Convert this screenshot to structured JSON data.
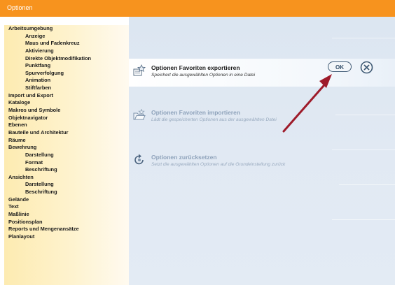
{
  "window": {
    "title": "Optionen"
  },
  "sidebar": {
    "items": [
      {
        "label": "Arbeitsumgebung",
        "level": 0
      },
      {
        "label": "Anzeige",
        "level": 1
      },
      {
        "label": "Maus und Fadenkreuz",
        "level": 1
      },
      {
        "label": "Aktivierung",
        "level": 1
      },
      {
        "label": "Direkte Objektmodifikation",
        "level": 1
      },
      {
        "label": "Punktfang",
        "level": 1
      },
      {
        "label": "Spurverfolgung",
        "level": 1
      },
      {
        "label": "Animation",
        "level": 1
      },
      {
        "label": "Stiftfarben",
        "level": 1
      },
      {
        "label": "Import und Export",
        "level": 0
      },
      {
        "label": "Kataloge",
        "level": 0
      },
      {
        "label": "Makros und Symbole",
        "level": 0
      },
      {
        "label": "Objektnavigator",
        "level": 0
      },
      {
        "label": "Ebenen",
        "level": 0
      },
      {
        "label": "Bauteile und Architektur",
        "level": 0
      },
      {
        "label": "Räume",
        "level": 0
      },
      {
        "label": "Bewehrung",
        "level": 0
      },
      {
        "label": "Darstellung",
        "level": 1
      },
      {
        "label": "Format",
        "level": 1
      },
      {
        "label": "Beschriftung",
        "level": 1
      },
      {
        "label": "Ansichten",
        "level": 0
      },
      {
        "label": "Darstellung",
        "level": 1
      },
      {
        "label": "Beschriftung",
        "level": 1
      },
      {
        "label": "Gelände",
        "level": 0
      },
      {
        "label": "Text",
        "level": 0
      },
      {
        "label": "Maßlinie",
        "level": 0
      },
      {
        "label": "Positionsplan",
        "level": 0
      },
      {
        "label": "Reports und Mengenansätze",
        "level": 0
      },
      {
        "label": "Planlayout",
        "level": 0
      }
    ]
  },
  "options": {
    "export": {
      "title": "Optionen Favoriten exportieren",
      "description": "Speichert die ausgewählten Optionen in eine Datei",
      "icon": "export-favorites-icon"
    },
    "import": {
      "title": "Optionen Favoriten importieren",
      "description": "Lädt die gespeicherten Optionen aus der ausgewählten Datei",
      "icon": "import-folder-icon"
    },
    "reset": {
      "title": "Optionen zurücksetzen",
      "description": "Setzt die ausgewählten Optionen auf die Grundeinstellung zurück",
      "icon": "reset-icon"
    }
  },
  "buttons": {
    "ok_label": "OK",
    "close_icon": "close-icon"
  },
  "colors": {
    "titlebar": "#f7931e",
    "sidebar": "#fdebb1",
    "main_background": "#dce6f1",
    "annotation_arrow": "#9e1b2a"
  }
}
